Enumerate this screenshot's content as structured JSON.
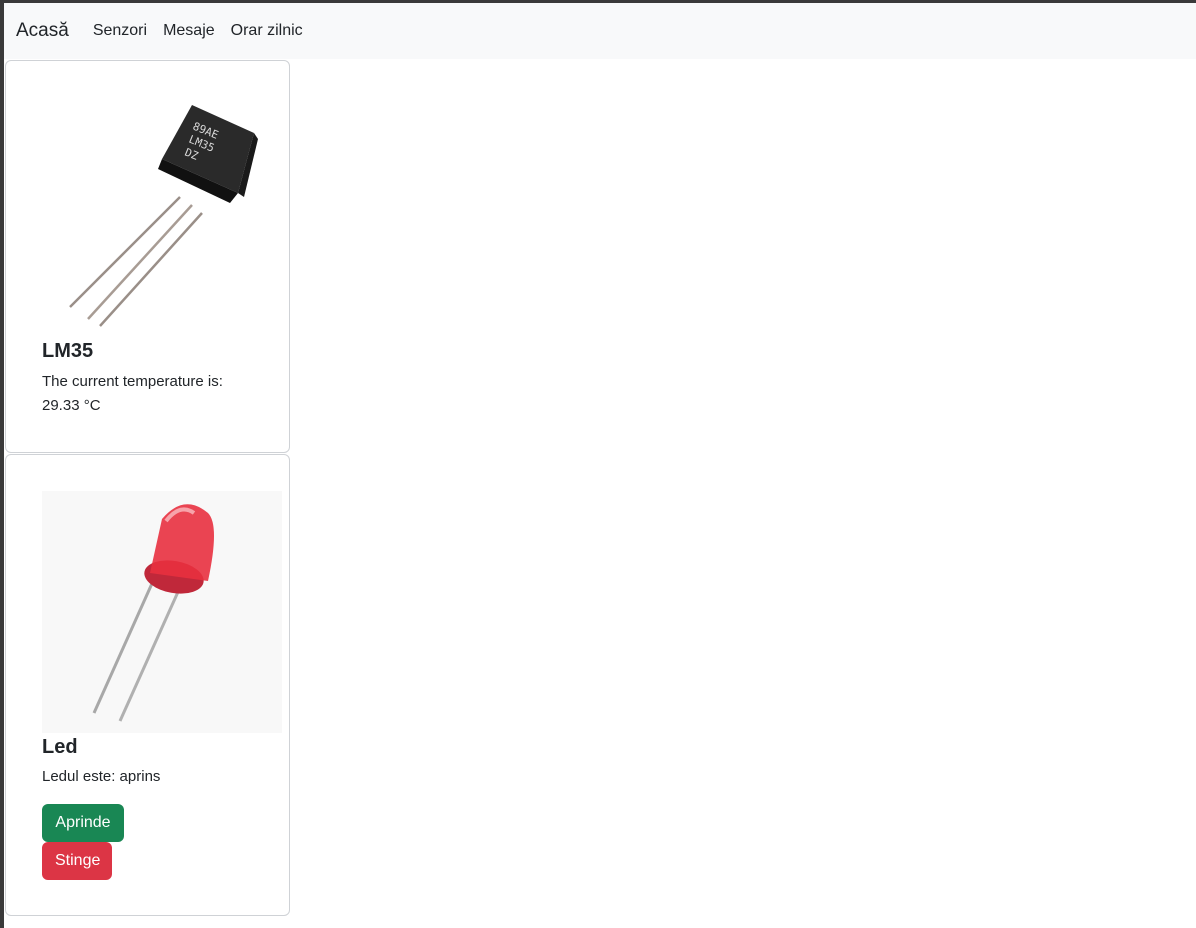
{
  "navbar": {
    "brand": "Acasă",
    "links": [
      "Senzori",
      "Mesaje",
      "Orar zilnic"
    ]
  },
  "cards": [
    {
      "title": "LM35",
      "image_icon": "lm35-sensor-image",
      "chip_marking": [
        "89AE",
        "LM35",
        "DZ"
      ],
      "text_line1": "The current temperature is:",
      "text_line2": "29.33 °C"
    },
    {
      "title": "Led",
      "image_icon": "red-led-image",
      "text": "Ledul este: aprins",
      "on_label": "Aprinde",
      "off_label": "Stinge"
    }
  ],
  "colors": {
    "navbar_bg": "#f8f9fa",
    "success": "#198754",
    "danger": "#dc3545"
  }
}
